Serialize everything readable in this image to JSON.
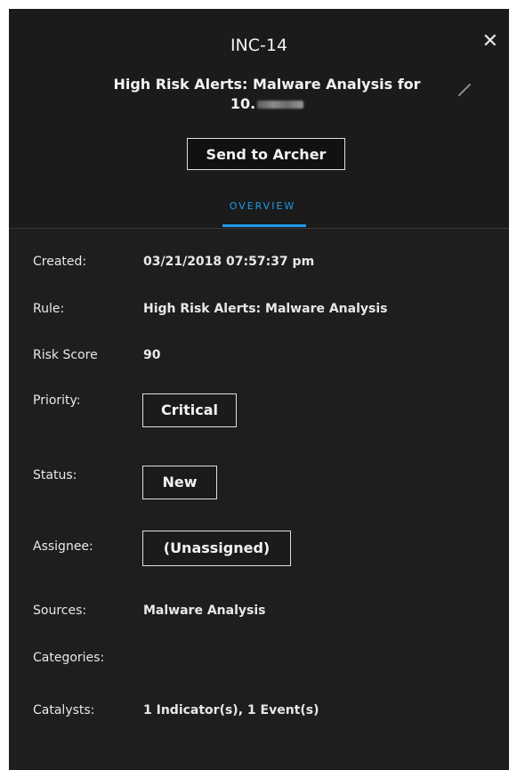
{
  "incident": {
    "id": "INC-14",
    "title_line1": "High Risk Alerts: Malware Analysis for",
    "title_line2_prefix": "10."
  },
  "actions": {
    "send_label": "Send to Archer"
  },
  "tabs": [
    {
      "label": "OVERVIEW",
      "active": true
    }
  ],
  "fields": {
    "created": {
      "label": "Created:",
      "value": "03/21/2018 07:57:37 pm"
    },
    "rule": {
      "label": "Rule:",
      "value": "High Risk Alerts: Malware Analysis"
    },
    "risk": {
      "label": "Risk Score",
      "value": "90"
    },
    "priority": {
      "label": "Priority:",
      "value": "Critical"
    },
    "status": {
      "label": "Status:",
      "value": "New"
    },
    "assignee": {
      "label": "Assignee:",
      "value": "(Unassigned)"
    },
    "sources": {
      "label": "Sources:",
      "value": "Malware Analysis"
    },
    "categories": {
      "label": "Categories:",
      "value": ""
    },
    "catalysts": {
      "label": "Catalysts:",
      "value": "1 Indicator(s), 1 Event(s)"
    }
  },
  "icons": {
    "close": "close-icon",
    "edit": "pencil-icon"
  },
  "colors": {
    "background": "#1e1e1e",
    "accent": "#1d9be9",
    "text": "#e8e8e8"
  }
}
